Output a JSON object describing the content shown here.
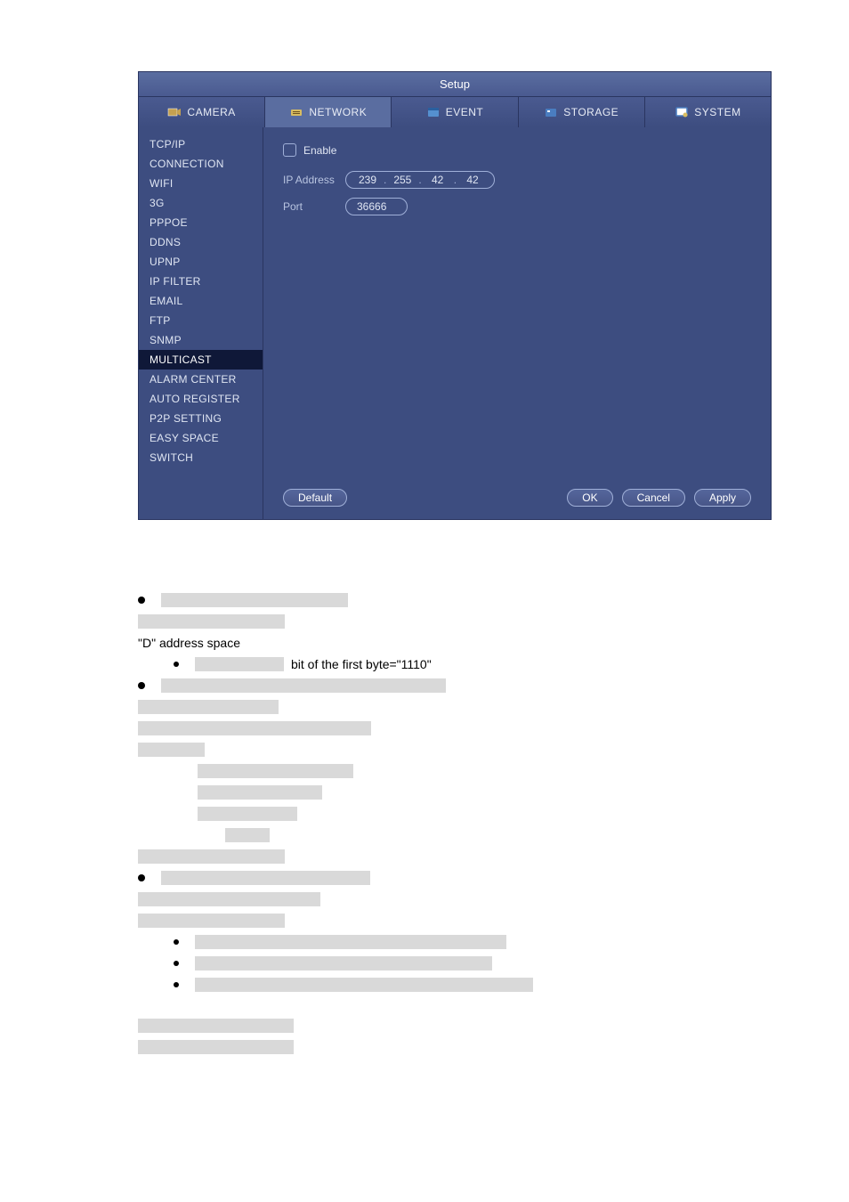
{
  "windowTitle": "Setup",
  "tabs": {
    "camera": "CAMERA",
    "network": "NETWORK",
    "event": "EVENT",
    "storage": "STORAGE",
    "system": "SYSTEM"
  },
  "sidebar": [
    "TCP/IP",
    "CONNECTION",
    "WIFI",
    "3G",
    "PPPOE",
    "DDNS",
    "UPNP",
    "IP FILTER",
    "EMAIL",
    "FTP",
    "SNMP",
    "MULTICAST",
    "ALARM CENTER",
    "AUTO REGISTER",
    "P2P SETTING",
    "EASY SPACE",
    "SWITCH"
  ],
  "activeSidebar": "MULTICAST",
  "content": {
    "enableLabel": "Enable",
    "ipLabel": "IP Address",
    "ipOctets": [
      "239",
      "255",
      "42",
      "42"
    ],
    "portLabel": "Port",
    "portValue": "36666"
  },
  "buttons": {
    "default": "Default",
    "ok": "OK",
    "cancel": "Cancel",
    "apply": "Apply"
  },
  "doc": {
    "dAddress": "\"D\" address space",
    "bitLine": "bit of the first byte=\"1110\""
  }
}
